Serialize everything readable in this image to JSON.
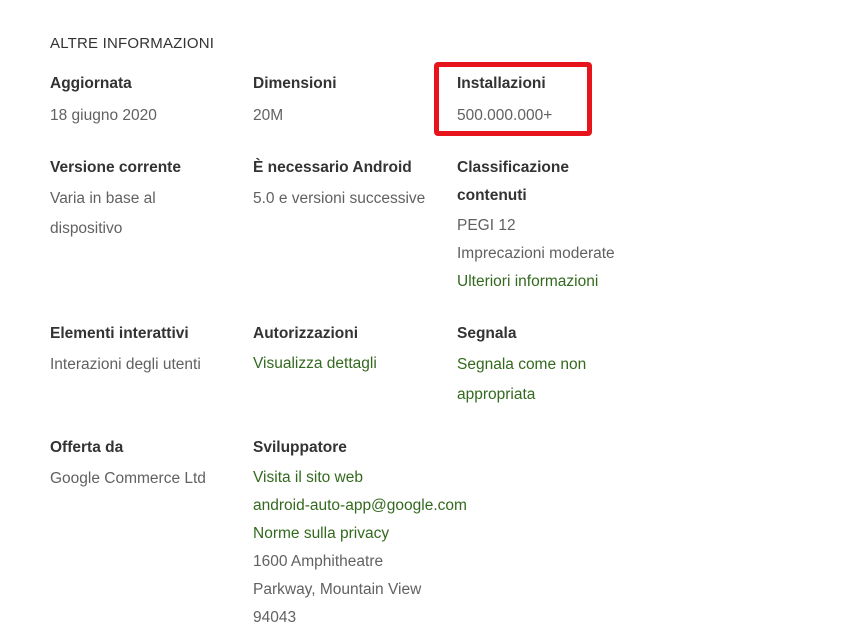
{
  "section_title": "ALTRE INFORMAZIONI",
  "updated": {
    "label": "Aggiornata",
    "value": "18 giugno 2020"
  },
  "size": {
    "label": "Dimensioni",
    "value": "20M"
  },
  "installs": {
    "label": "Installazioni",
    "value": "500.000.000+"
  },
  "current_version": {
    "label": "Versione corrente",
    "value_line1": "Varia in base al",
    "value_line2": "dispositivo"
  },
  "requires_android": {
    "label": "È necessario Android",
    "value": "5.0 e versioni successive"
  },
  "content_rating": {
    "label_line1": "Classificazione",
    "label_line2": "contenuti",
    "rating": "PEGI 12",
    "descriptor": "Imprecazioni moderate",
    "more_link": "Ulteriori informazioni"
  },
  "interactive_elements": {
    "label": "Elementi interattivi",
    "value": "Interazioni degli utenti"
  },
  "permissions": {
    "label": "Autorizzazioni",
    "link": "Visualizza dettagli"
  },
  "report": {
    "label": "Segnala",
    "link_line1": "Segnala come non",
    "link_line2": "appropriata"
  },
  "offered_by": {
    "label": "Offerta da",
    "value": "Google Commerce Ltd"
  },
  "developer": {
    "label": "Sviluppatore",
    "website_link": "Visita il sito web",
    "email_link": "android-auto-app@google.com",
    "privacy_link": "Norme sulla privacy",
    "address_line1": "1600 Amphitheatre",
    "address_line2": "Parkway, Mountain View",
    "address_line3": "94043"
  },
  "colors": {
    "link": "#33691e",
    "highlight": "#e8141b",
    "label": "#333333",
    "value": "#616161"
  }
}
